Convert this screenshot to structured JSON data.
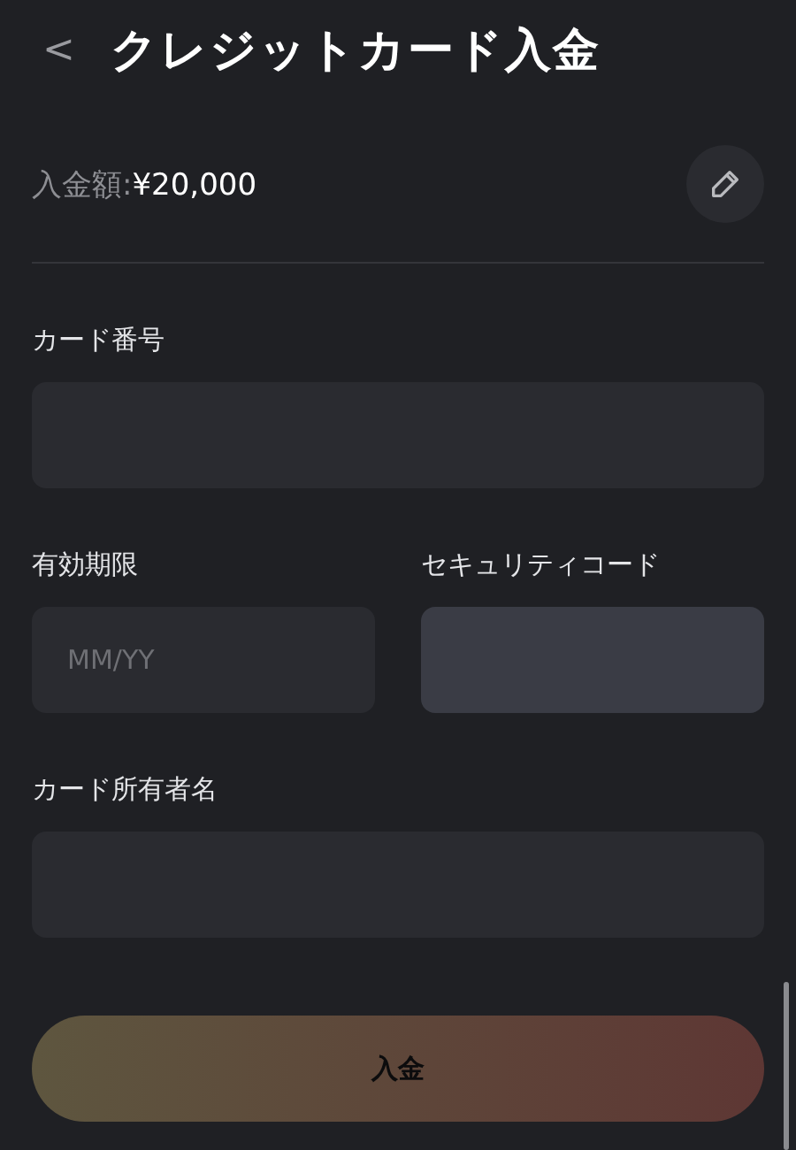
{
  "header": {
    "back": "<",
    "title": "クレジットカード入金"
  },
  "amount": {
    "label": "入金額:",
    "value": "¥20,000"
  },
  "rows": [
    [
      {
        "label": "カード番号",
        "focused": false
      }
    ],
    [
      {
        "label": "有効期限",
        "placeholder": "MM/YY",
        "focused": false
      },
      {
        "label": "セキュリティコード",
        "focused": true
      }
    ],
    [
      {
        "label": "カード所有者名",
        "focused": false
      }
    ]
  ],
  "submit": {
    "label": "入金",
    "disabled": true
  }
}
